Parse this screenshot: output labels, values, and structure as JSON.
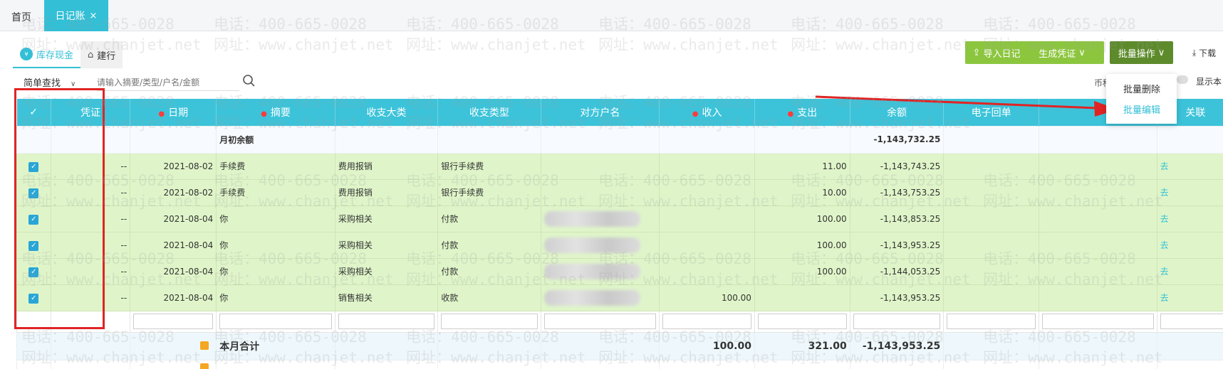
{
  "topbar": {
    "home": "首页",
    "active_tab": "日记账",
    "close": "×"
  },
  "subtabs": [
    {
      "label": "库存现金",
      "icon": "cash-icon"
    },
    {
      "label": "建行",
      "icon": "house-icon"
    }
  ],
  "toolbar": {
    "import_label": "导入日记账",
    "voucher_label": "生成凭证",
    "batch_label": "批量操作",
    "download_label": "下载"
  },
  "search": {
    "mode": "简单查找",
    "placeholder": "请输入摘要/类型/户名/金额"
  },
  "currency_label": "币种",
  "show_label": "显示本",
  "dropdown": {
    "delete": "批量删除",
    "edit": "批量编辑"
  },
  "table": {
    "headers": [
      "✓",
      "凭证",
      "日期",
      "摘要",
      "收支大类",
      "收支类型",
      "对方户名",
      "收入",
      "支出",
      "余额",
      "电子回单",
      "",
      "关联"
    ],
    "opening": {
      "label": "月初余额",
      "balance": "-1,143,732.25"
    },
    "rows": [
      {
        "voucher": "--",
        "date": "2021-08-02",
        "summary": "手续费",
        "category": "费用报销",
        "type": "银行手续费",
        "counterparty": "",
        "income": "",
        "expense": "11.00",
        "balance": "-1,143,743.25",
        "link": "去"
      },
      {
        "voucher": "--",
        "date": "2021-08-02",
        "summary": "手续费",
        "category": "费用报销",
        "type": "银行手续费",
        "counterparty": "",
        "income": "",
        "expense": "10.00",
        "balance": "-1,143,753.25",
        "link": "去"
      },
      {
        "voucher": "--",
        "date": "2021-08-04",
        "summary": "你",
        "category": "采购相关",
        "type": "付款",
        "counterparty": "",
        "income": "",
        "expense": "100.00",
        "balance": "-1,143,853.25",
        "link": "去"
      },
      {
        "voucher": "--",
        "date": "2021-08-04",
        "summary": "你",
        "category": "采购相关",
        "type": "付款",
        "counterparty": "",
        "income": "",
        "expense": "100.00",
        "balance": "-1,143,953.25",
        "link": "去"
      },
      {
        "voucher": "--",
        "date": "2021-08-04",
        "summary": "你",
        "category": "采购相关",
        "type": "付款",
        "counterparty": "",
        "income": "",
        "expense": "100.00",
        "balance": "-1,144,053.25",
        "link": "去"
      },
      {
        "voucher": "--",
        "date": "2021-08-04",
        "summary": "你",
        "category": "销售相关",
        "type": "收款",
        "counterparty": "",
        "income": "100.00",
        "expense": "",
        "balance": "-1,143,953.25",
        "link": "去"
      }
    ],
    "total": {
      "label": "本月合计",
      "income": "100.00",
      "expense": "321.00",
      "balance": "-1,143,953.25"
    }
  },
  "watermark": {
    "phone": "电话：400-665-0028",
    "site": "网址：www.chanjet.net"
  },
  "colors": {
    "header": "#3cc3d9",
    "row_selected": "#dff5c9",
    "accent": "#33bfd6",
    "green_btn": "#8cc63f",
    "annotation": "#e02424"
  }
}
